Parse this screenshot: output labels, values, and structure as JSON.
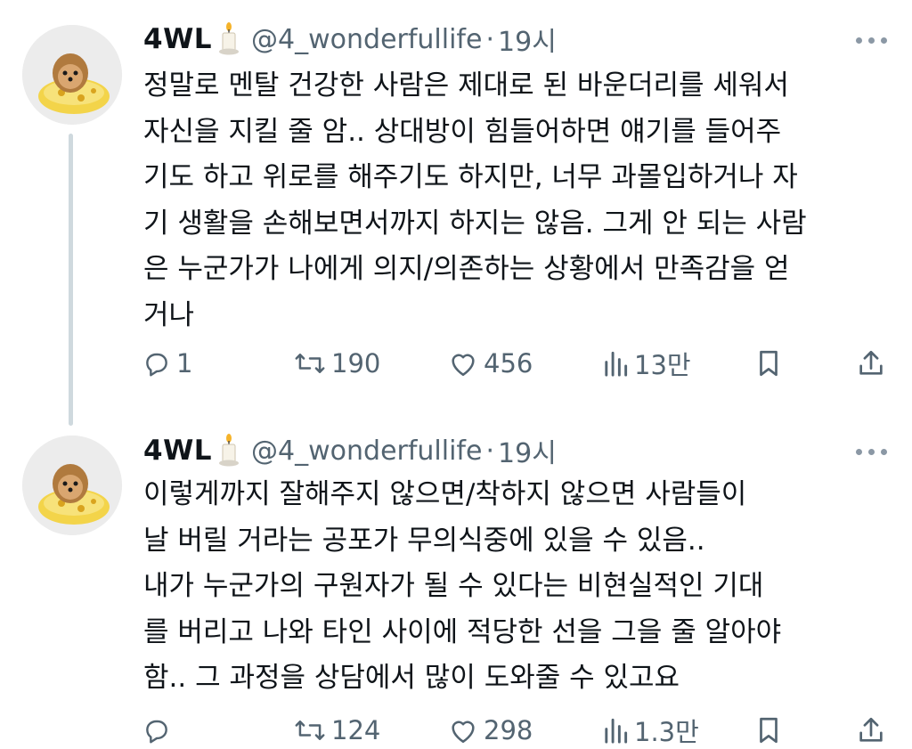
{
  "tweets": [
    {
      "author": {
        "name": "4WL",
        "emoji": "candle-icon",
        "handle": "@4_wonderfullife"
      },
      "separator": "·",
      "time": "19시",
      "text": "정말로 멘탈 건강한 사람은 제대로 된 바운더리를 세워서\n자신을 지킬 줄 암.. 상대방이 힘들어하면 얘기를 들어주\n기도 하고 위로를 해주기도 하지만, 너무 과몰입하거나 자\n기 생활을 손해보면서까지 하지는 않음. 그게 안 되는 사람\n은 누군가가 나에게 의지/의존하는 상황에서 만족감을 얻\n거나",
      "stats": {
        "replies": "1",
        "retweets": "190",
        "likes": "456",
        "views": "13만"
      }
    },
    {
      "author": {
        "name": "4WL",
        "emoji": "candle-icon",
        "handle": "@4_wonderfullife"
      },
      "separator": "·",
      "time": "19시",
      "text": "이렇게까지 잘해주지 않으면/착하지 않으면 사람들이\n날 버릴 거라는 공포가 무의식중에 있을 수 있음..\n내가 누군가의 구원자가 될 수 있다는 비현실적인 기대\n를 버리고 나와 타인 사이에 적당한 선을 그을 줄 알아야\n함.. 그 과정을 상담에서 많이 도와줄 수 있고요",
      "stats": {
        "replies": "",
        "retweets": "124",
        "likes": "298",
        "views": "1.3만"
      }
    }
  ],
  "colors": {
    "text": "#0f1419",
    "secondary": "#536471",
    "thread_line": "#cfd9de"
  }
}
